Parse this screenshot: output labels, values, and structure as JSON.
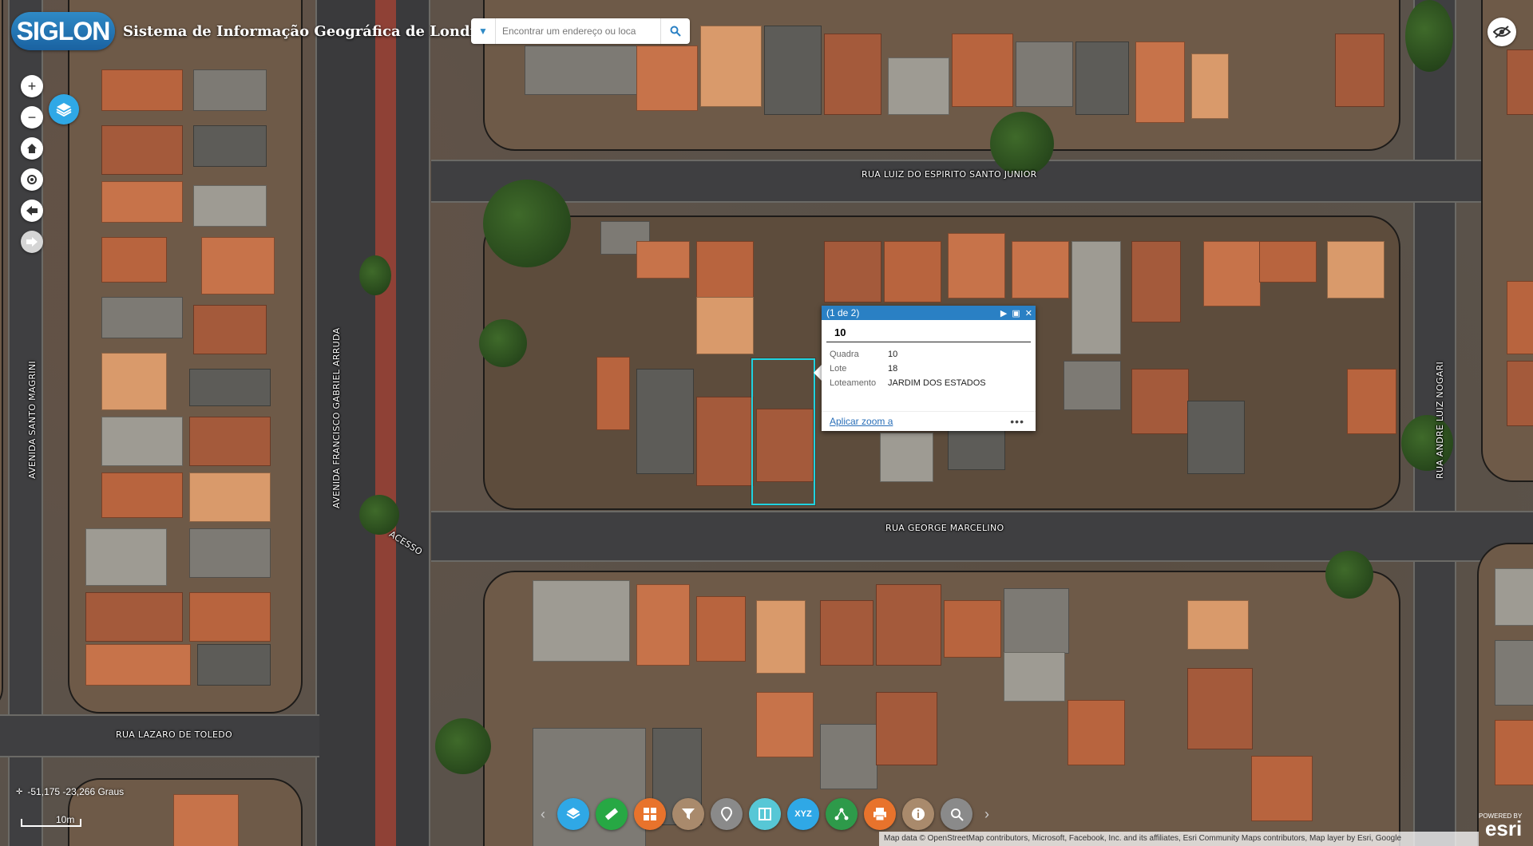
{
  "header": {
    "logo_text": "SIGLON",
    "title": "Sistema de Informação Geográfica de Londrina"
  },
  "search": {
    "placeholder": "Encontrar um endereço ou loca"
  },
  "map": {
    "streets": {
      "rua_luiz": "RUA LUIZ DO ESPIRITO SANTO JUNIOR",
      "rua_george": "RUA GEORGE MARCELINO",
      "rua_lazaro": "RUA LAZARO DE TOLEDO",
      "av_santo": "AVENIDA SANTO MAGRINI",
      "av_francisco": "AVENIDA FRANCISCO GABRIEL ARRUDA",
      "acesso": "ACESSO",
      "rua_andre": "RUA ANDRE LUIZ NOGARI"
    }
  },
  "popup": {
    "counter": "(1 de 2)",
    "title": "10",
    "attributes": [
      {
        "key": "Quadra",
        "value": "10"
      },
      {
        "key": "Lote",
        "value": "18"
      },
      {
        "key": "Loteamento",
        "value": "JARDIM DOS ESTADOS"
      }
    ],
    "zoom_link": "Aplicar zoom a",
    "more": "•••"
  },
  "status": {
    "coordinates": "-51,175 -23,266 Graus",
    "scale_label": "10m"
  },
  "attribution": "Map data © OpenStreetMap contributors, Microsoft, Facebook, Inc. and its affiliates, Esri Community Maps contributors, Map layer by Esri, Google",
  "esri": {
    "powered_by": "POWERED BY",
    "name": "esri"
  },
  "colors": {
    "accent": "#2a80c4",
    "selection": "#1fd3e0",
    "toolbar": [
      "#2fa8e6",
      "#27a844",
      "#e8732c",
      "#a98a6c",
      "#8a8a8a",
      "#57c7d6",
      "#2fa8e6",
      "#2e9a4a",
      "#e8732c",
      "#a98a6c",
      "#8a8a8a"
    ]
  },
  "toolbar": {
    "icons": [
      "layers-icon",
      "ruler-icon",
      "grid-icon",
      "filter-icon",
      "location-pin-icon",
      "split-view-icon",
      "xyz-icon",
      "network-icon",
      "print-icon",
      "info-icon",
      "search-map-icon"
    ],
    "xyz_label": "XYZ"
  }
}
